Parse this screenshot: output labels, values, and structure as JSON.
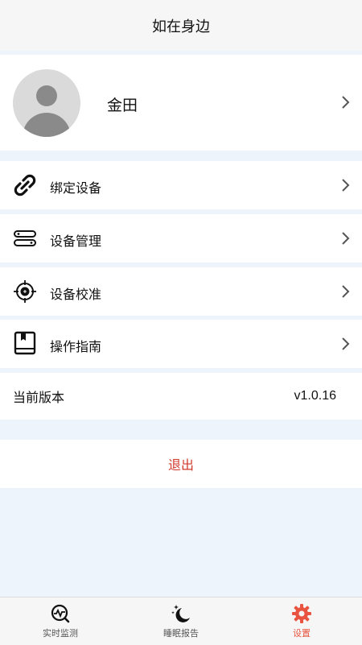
{
  "header": {
    "title": "如在身边"
  },
  "profile": {
    "name": "金田"
  },
  "menu": [
    {
      "label": "绑定设备",
      "icon": "link-icon"
    },
    {
      "label": "设备管理",
      "icon": "device-manage-icon"
    },
    {
      "label": "设备校准",
      "icon": "target-icon"
    },
    {
      "label": "操作指南",
      "icon": "book-icon"
    }
  ],
  "version": {
    "label": "当前版本",
    "value": "v1.0.16"
  },
  "logout": {
    "label": "退出"
  },
  "tabs": [
    {
      "label": "实时监测",
      "icon": "monitor-icon",
      "active": false
    },
    {
      "label": "睡眠报告",
      "icon": "moon-stars-icon",
      "active": false
    },
    {
      "label": "设置",
      "icon": "gear-icon",
      "active": true
    }
  ],
  "colors": {
    "accent": "#e8543f",
    "logout": "#d23a2e",
    "background": "#edf4fc"
  }
}
